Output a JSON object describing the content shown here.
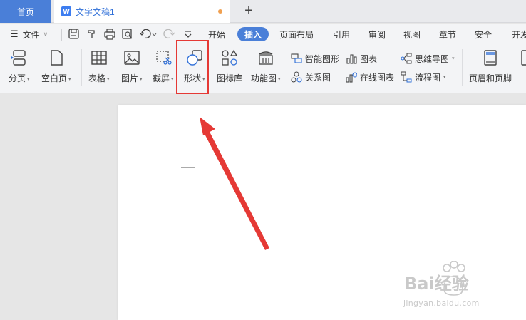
{
  "tabs": {
    "home_label": "首页",
    "doc_icon_letter": "W",
    "doc_title": "文字文稿1",
    "new_tab_glyph": "+"
  },
  "menu": {
    "file_label": "文件",
    "items": [
      "开始",
      "插入",
      "页面布局",
      "引用",
      "审阅",
      "视图",
      "章节",
      "安全",
      "开发"
    ],
    "active_item": "插入"
  },
  "ribbon": {
    "page_break": "分页",
    "blank_page": "空白页",
    "table": "表格",
    "picture": "图片",
    "screenshot": "截屏",
    "shape": "形状",
    "icon_library": "图标库",
    "function_chart": "功能图",
    "smart_art": "智能图形",
    "relation_chart": "关系图",
    "chart": "图表",
    "online_chart": "在线图表",
    "mind_map": "思维导图",
    "flowchart": "流程图",
    "header_footer": "页眉和页脚"
  },
  "watermark": {
    "brand": "Bai经验",
    "url": "jingyan.baidu.com"
  },
  "colors": {
    "accent": "#4a7fd8",
    "highlight_box": "#e53935",
    "arrow": "#e53935"
  }
}
